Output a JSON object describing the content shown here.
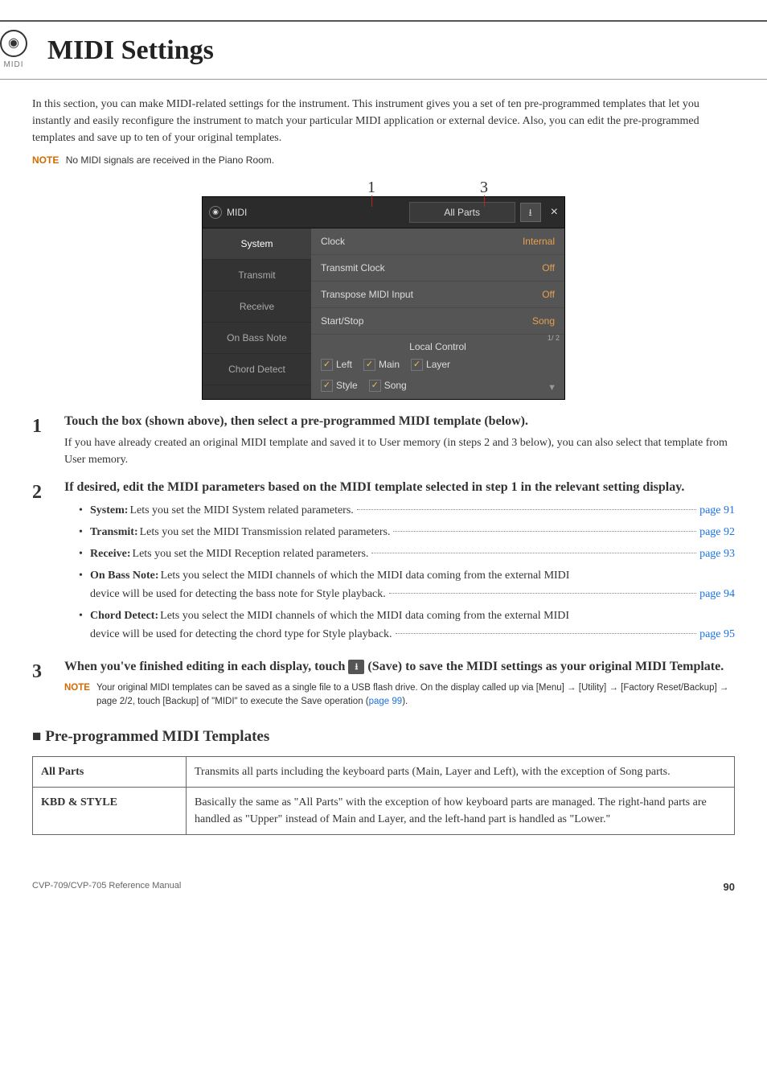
{
  "header": {
    "icon_label": "MIDI",
    "title": "MIDI Settings"
  },
  "intro": "In this section, you can make MIDI-related settings for the instrument. This instrument gives you a set of ten pre-programmed templates that let you instantly and easily reconfigure the instrument to match your particular MIDI application or external device. Also, you can edit the pre-programmed templates and save up to ten of your original templates.",
  "note_label": "NOTE",
  "note_text": "No MIDI signals are received in the Piano Room.",
  "pointers": {
    "a": "1",
    "b": "3"
  },
  "screenshot": {
    "title": "MIDI",
    "dropdown": "All Parts",
    "save_glyph": "⭳",
    "close_glyph": "×",
    "side": [
      "System",
      "Transmit",
      "Receive",
      "On Bass Note",
      "Chord Detect"
    ],
    "rows": [
      {
        "k": "Clock",
        "v": "Internal"
      },
      {
        "k": "Transmit Clock",
        "v": "Off"
      },
      {
        "k": "Transpose MIDI Input",
        "v": "Off"
      },
      {
        "k": "Start/Stop",
        "v": "Song"
      }
    ],
    "local_label": "Local Control",
    "checks": [
      "Left",
      "Main",
      "Layer",
      "Style",
      "Song"
    ],
    "pager": "1/ 2"
  },
  "steps": {
    "s1": {
      "num": "1",
      "head": "Touch the box (shown above), then select a pre-programmed MIDI template (below).",
      "sub": "If you have already created an original MIDI template and saved it to User memory (in steps 2 and 3 below), you can also select that template from User memory."
    },
    "s2": {
      "num": "2",
      "head": "If desired, edit the MIDI parameters based on the MIDI template selected in step 1 in the relevant setting display.",
      "items": [
        {
          "label": "System:",
          "desc": " Lets you set the MIDI System related parameters.",
          "cont": "",
          "page": "page 91"
        },
        {
          "label": "Transmit:",
          "desc": " Lets you set the MIDI Transmission related parameters.",
          "cont": "",
          "page": "page 92"
        },
        {
          "label": "Receive:",
          "desc": " Lets you set the MIDI Reception related parameters.",
          "cont": "",
          "page": "page 93"
        },
        {
          "label": "On Bass Note:",
          "desc": " Lets you select the MIDI channels of which the MIDI data coming from the external MIDI",
          "cont": "device will be used for detecting the bass note for Style playback.",
          "page": "page 94"
        },
        {
          "label": "Chord Detect:",
          "desc": " Lets you select the MIDI channels of which the MIDI data coming from the external MIDI",
          "cont": "device will be used for detecting the chord type for Style playback.",
          "page": "page 95"
        }
      ]
    },
    "s3": {
      "num": "3",
      "head_a": "When you've finished editing in each display, touch ",
      "head_b": " (Save) to save the MIDI settings as your original MIDI Template.",
      "icon": "⭳",
      "note_a": "Your original MIDI templates can be saved as a single file to a USB flash drive. On the display called up via [Menu] → [Utility] → [Factory Reset/Backup] → page 2/2, touch [Backup] of \"MIDI\" to execute the Save operation (",
      "note_link": "page 99",
      "note_b": ")."
    }
  },
  "templates_heading": "Pre-programmed MIDI Templates",
  "templates": [
    {
      "name": "All Parts",
      "desc": "Transmits all parts including the keyboard parts (Main, Layer and Left), with the exception of Song parts."
    },
    {
      "name": "KBD & STYLE",
      "desc": "Basically the same as \"All Parts\" with the exception of how keyboard parts are managed. The right-hand parts are handled as \"Upper\" instead of Main and Layer, and the left-hand part is handled as \"Lower.\""
    }
  ],
  "footer": {
    "ref": "CVP-709/CVP-705 Reference Manual",
    "page": "90"
  }
}
